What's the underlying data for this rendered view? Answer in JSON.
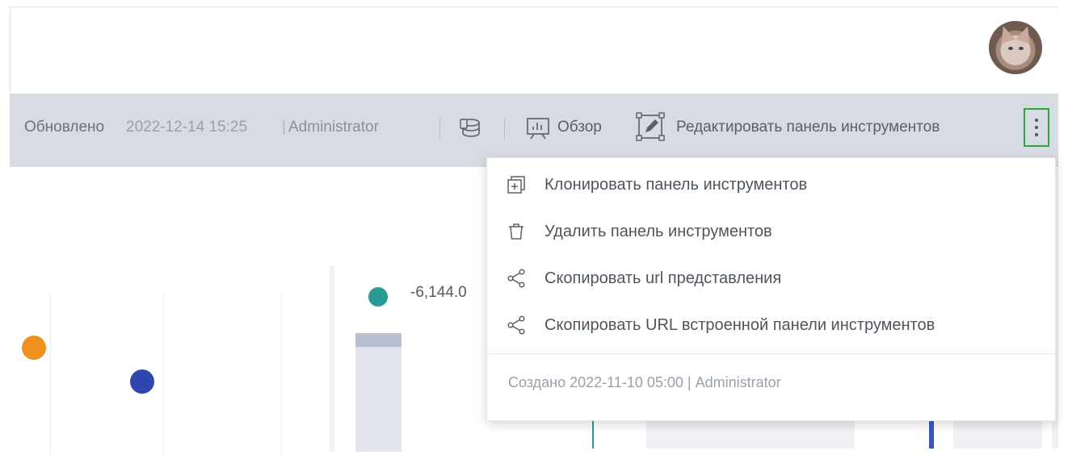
{
  "header": {
    "avatar_name": "user-avatar"
  },
  "toolbar": {
    "updated_label": "Обновлено",
    "updated_value": "2022-12-14 15:25",
    "separator": "|",
    "updated_user": "Administrator",
    "overview_label": "Обзор",
    "edit_label": "Редактировать панель инструментов"
  },
  "dashboard": {
    "legend_value": "-6,144.0"
  },
  "menu": {
    "items": [
      {
        "label": "Клонировать панель инструментов",
        "icon": "clone-icon"
      },
      {
        "label": "Удалить панель инструментов",
        "icon": "trash-icon"
      },
      {
        "label": "Скопировать url представления",
        "icon": "share-icon"
      },
      {
        "label": "Скопировать URL встроенной панели инструментов",
        "icon": "share-icon"
      }
    ],
    "footer": "Создано 2022-11-10 05:00 | Administrator"
  },
  "colors": {
    "accent_green": "#2fa53c",
    "series_teal": "#2a9a94",
    "marker_orange": "#f0901e",
    "marker_blue": "#2f45b0"
  }
}
